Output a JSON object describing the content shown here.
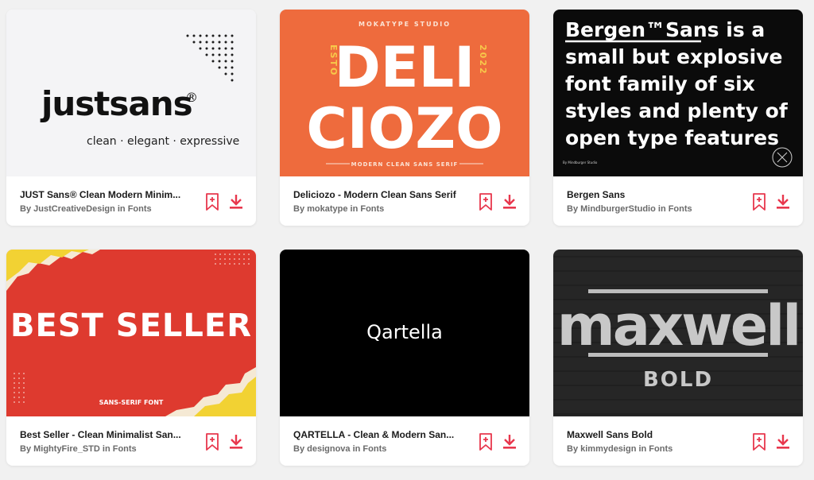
{
  "colors": {
    "accent": "#e8374d"
  },
  "action_icons": {
    "bookmark": "bookmark-plus-icon",
    "download": "download-icon"
  },
  "cards": [
    {
      "title": "JUST Sans® Clean Modern Minim...",
      "byline": "By JustCreativeDesign in Fonts",
      "preview": {
        "wordmark": "justsans",
        "registered": "®",
        "tagline": "clean · elegant · expressive"
      }
    },
    {
      "title": "Deliciozo - Modern Clean Sans Serif",
      "byline": "By mokatype in Fonts",
      "preview": {
        "studio": "MOKATYPE STUDIO",
        "line1": "DELI",
        "line2": "CIOZO",
        "left_vert": "ESTO",
        "right_vert": "2022",
        "footer": "MODERN CLEAN SANS SERIF"
      }
    },
    {
      "title": "Bergen Sans",
      "byline": "By MindburgerStudio in Fonts",
      "preview": {
        "lines": [
          "Bergen™Sans is a",
          "small but explosive",
          "font family of six",
          "styles and plenty of",
          "open type features"
        ],
        "credit": "By Mindburger Studio"
      }
    },
    {
      "title": "Best Seller - Clean Minimalist San...",
      "byline": "By MightyFire_STD in Fonts",
      "preview": {
        "headline": "BEST SELLER",
        "sub": "SANS-SERIF FONT"
      }
    },
    {
      "title": "QARTELLA - Clean & Modern San...",
      "byline": "By designova in Fonts",
      "preview": {
        "wordmark": "Qartella"
      }
    },
    {
      "title": "Maxwell Sans Bold",
      "byline": "By kimmydesign in Fonts",
      "preview": {
        "line1": "maxwell",
        "line2": "BOLD"
      }
    }
  ]
}
